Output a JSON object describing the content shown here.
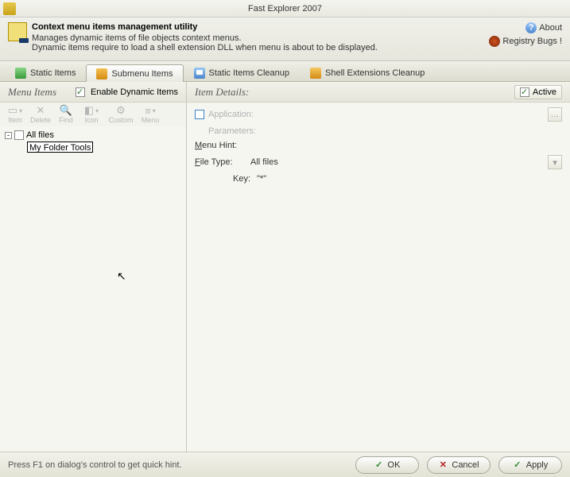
{
  "window": {
    "title": "Fast Explorer 2007"
  },
  "header": {
    "title": "Context menu items management utility",
    "line1": "Manages dynamic items of file objects context menus.",
    "line2": "Dynamic items require to load a shell extension DLL when menu is about to be displayed.",
    "about": "About",
    "registry": "Registry Bugs !"
  },
  "tabs": {
    "static": "Static Items",
    "submenu": "Submenu Items",
    "cleanup": "Static Items Cleanup",
    "shellext": "Shell Extensions Cleanup"
  },
  "left": {
    "title": "Menu Items",
    "enable": "Enable Dynamic Items",
    "toolbar": {
      "item": "Item",
      "delete": "Delete",
      "find": "Find",
      "icon": "Icon",
      "custom": "Custom",
      "menu": "Menu"
    },
    "root": "All files",
    "editValue": "My Folder Tools"
  },
  "right": {
    "title": "Item Details:",
    "active": "Active",
    "appLabel": "Application:",
    "paramsLabel": "Parameters:",
    "hintLabel": "Menu Hint:",
    "typeLabel": "File Type:",
    "typeValue": "All files",
    "keyLabel": "Key:",
    "keyValue": "\"*\""
  },
  "status": {
    "text": "Press F1 on dialog's control to get quick hint."
  },
  "buttons": {
    "ok": "OK",
    "cancel": "Cancel",
    "apply": "Apply"
  }
}
